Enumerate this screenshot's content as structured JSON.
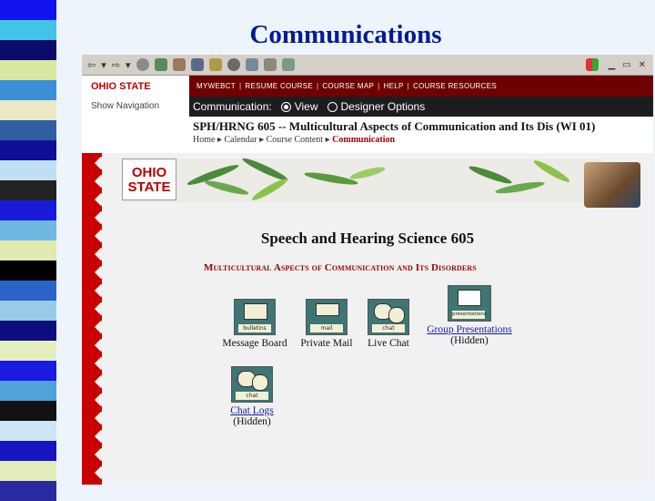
{
  "slide": {
    "title": "Communications"
  },
  "browser": {
    "toolbar_glyphs": [
      "⇦",
      "▾",
      "⇨",
      "▾"
    ],
    "controls": [
      "▁",
      "▭",
      "✕"
    ]
  },
  "header": {
    "brand": "OHIO STATE",
    "show_navigation": "Show Navigation",
    "nav_items": [
      "MYWEBCT",
      "RESUME COURSE",
      "COURSE MAP",
      "HELP",
      "COURSE RESOURCES"
    ],
    "mode_label": "Communication:",
    "view_label": "View",
    "designer_label": "Designer Options"
  },
  "course": {
    "title": "SPH/HRNG 605 -- Multicultural Aspects of Communication and Its Dis (WI 01)",
    "breadcrumbs": [
      "Home",
      "Calendar",
      "Course Content",
      "Communication"
    ],
    "crumb_sep": "▸"
  },
  "page": {
    "logo_line1": "OHIO",
    "logo_line2": "STATE",
    "heading": "Speech and Hearing Science 605",
    "subheading": "Multicultural Aspects of Communication and Its Disorders",
    "tools": [
      {
        "label": "Message Board",
        "caption": "bulletins",
        "sub": ""
      },
      {
        "label": "Private Mail",
        "caption": "mail",
        "sub": ""
      },
      {
        "label": "Live Chat",
        "caption": "chat",
        "sub": ""
      },
      {
        "label": "Group Presentations",
        "caption": "presentations",
        "sub": "(Hidden)"
      },
      {
        "label": "Chat Logs",
        "caption": "chat",
        "sub": "(Hidden)"
      }
    ]
  },
  "colors": {
    "title": "#001a99",
    "osu_red": "#bb0000",
    "nav_bar": "#6e0000"
  }
}
